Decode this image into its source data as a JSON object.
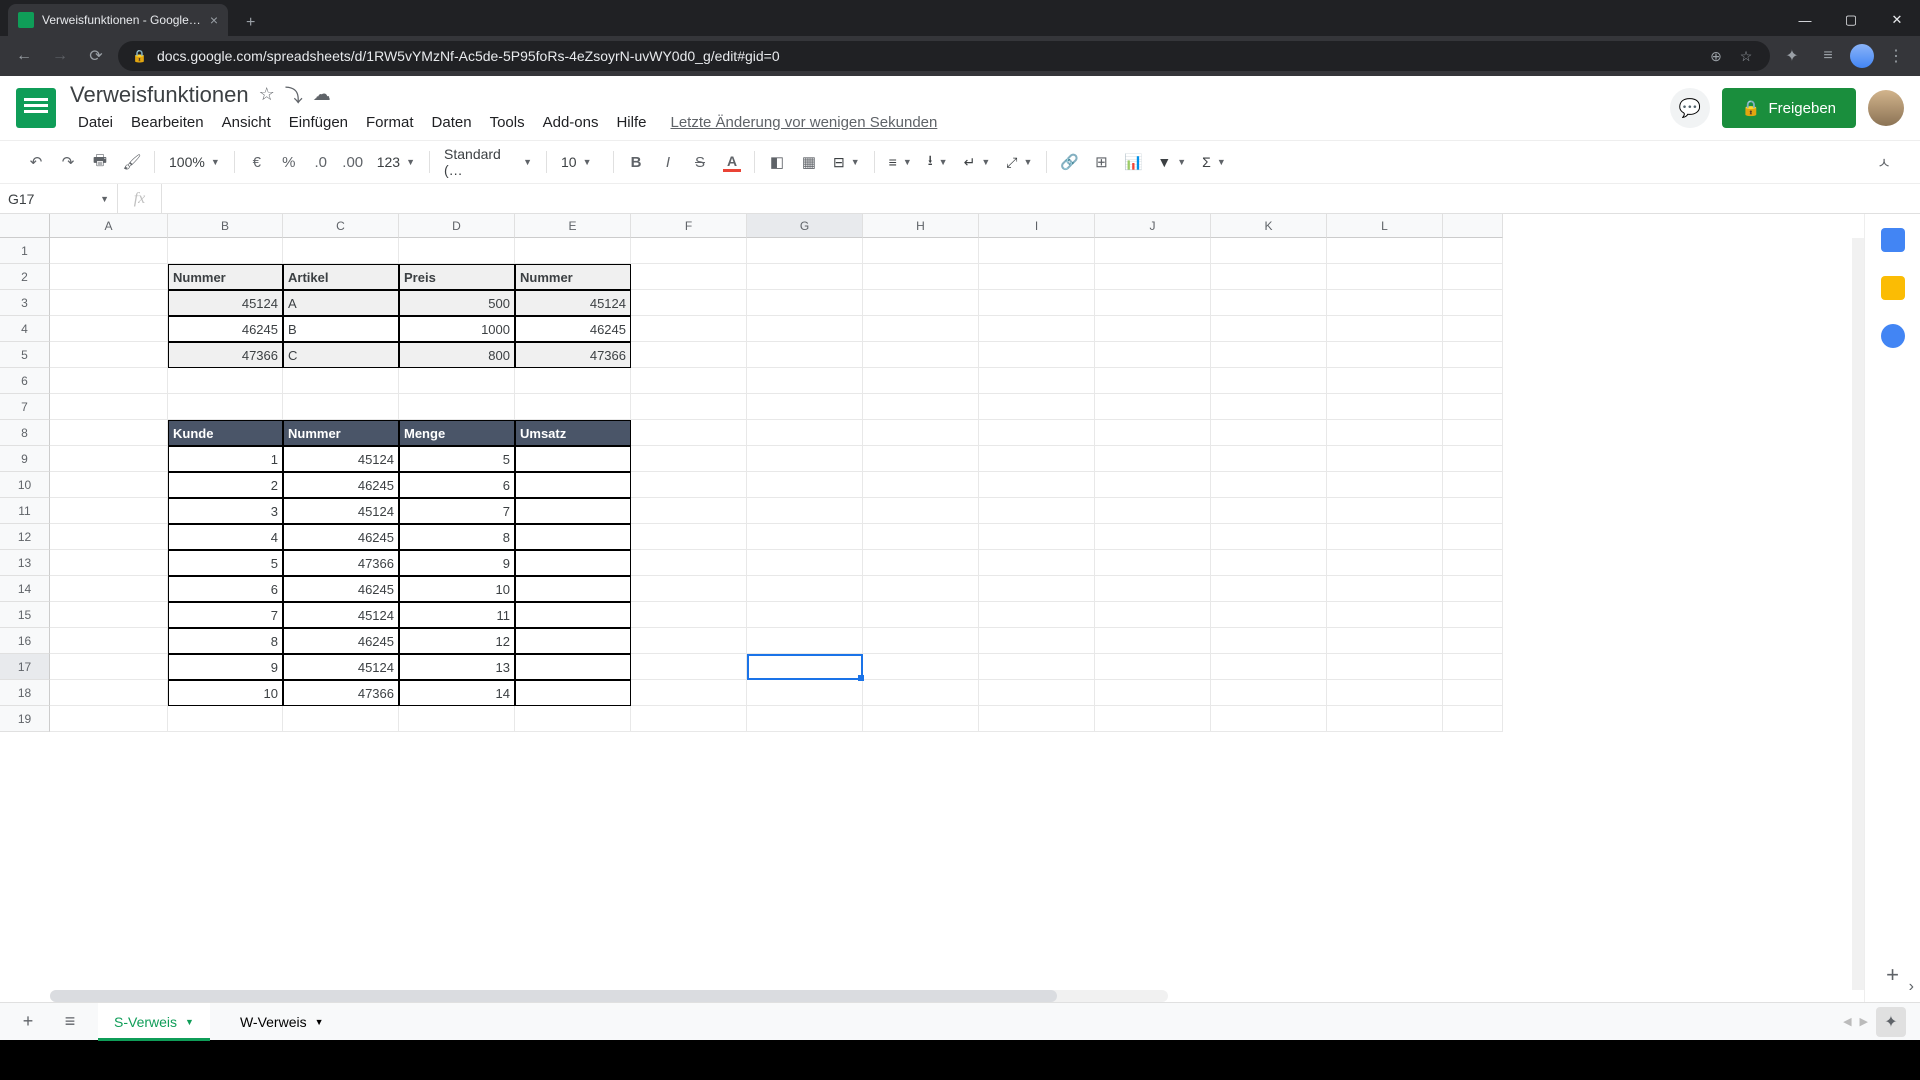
{
  "browser": {
    "tab_title": "Verweisfunktionen - Google Tabe",
    "url": "docs.google.com/spreadsheets/d/1RW5vYMzNf-Ac5de-5P95foRs-4eZsoyrN-uvWY0d0_g/edit#gid=0"
  },
  "doc": {
    "title": "Verweisfunktionen",
    "last_edit": "Letzte Änderung vor wenigen Sekunden",
    "share_label": "Freigeben"
  },
  "menus": [
    "Datei",
    "Bearbeiten",
    "Ansicht",
    "Einfügen",
    "Format",
    "Daten",
    "Tools",
    "Add-ons",
    "Hilfe"
  ],
  "toolbar": {
    "zoom": "100%",
    "currency": "€",
    "percent": "%",
    "dec_less": ".0",
    "dec_more": ".00",
    "numfmt": "123",
    "font": "Standard (…",
    "fontsize": "10"
  },
  "name_box": "G17",
  "columns": [
    "A",
    "B",
    "C",
    "D",
    "E",
    "F",
    "G",
    "H",
    "I",
    "J",
    "K",
    "L"
  ],
  "row_count": 19,
  "active_cell": {
    "row": 17,
    "col": "G"
  },
  "table1": {
    "headers": [
      "Nummer",
      "Artikel",
      "Preis",
      "Nummer"
    ],
    "rows": [
      {
        "nummer": "45124",
        "artikel": "A",
        "preis": "500",
        "nummer2": "45124"
      },
      {
        "nummer": "46245",
        "artikel": "B",
        "preis": "1000",
        "nummer2": "46245"
      },
      {
        "nummer": "47366",
        "artikel": "C",
        "preis": "800",
        "nummer2": "47366"
      }
    ]
  },
  "table2": {
    "headers": [
      "Kunde",
      "Nummer",
      "Menge",
      "Umsatz"
    ],
    "rows": [
      {
        "kunde": "1",
        "nummer": "45124",
        "menge": "5",
        "umsatz": ""
      },
      {
        "kunde": "2",
        "nummer": "46245",
        "menge": "6",
        "umsatz": ""
      },
      {
        "kunde": "3",
        "nummer": "45124",
        "menge": "7",
        "umsatz": ""
      },
      {
        "kunde": "4",
        "nummer": "46245",
        "menge": "8",
        "umsatz": ""
      },
      {
        "kunde": "5",
        "nummer": "47366",
        "menge": "9",
        "umsatz": ""
      },
      {
        "kunde": "6",
        "nummer": "46245",
        "menge": "10",
        "umsatz": ""
      },
      {
        "kunde": "7",
        "nummer": "45124",
        "menge": "11",
        "umsatz": ""
      },
      {
        "kunde": "8",
        "nummer": "46245",
        "menge": "12",
        "umsatz": ""
      },
      {
        "kunde": "9",
        "nummer": "45124",
        "menge": "13",
        "umsatz": ""
      },
      {
        "kunde": "10",
        "nummer": "47366",
        "menge": "14",
        "umsatz": ""
      }
    ]
  },
  "sheets": [
    {
      "name": "S-Verweis",
      "active": true
    },
    {
      "name": "W-Verweis",
      "active": false
    }
  ]
}
